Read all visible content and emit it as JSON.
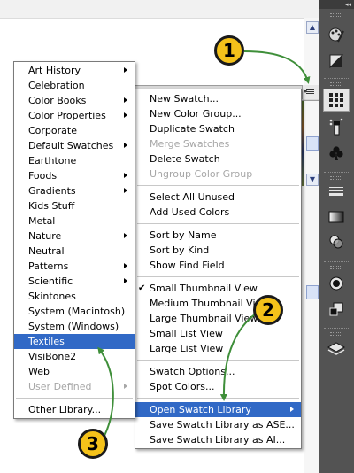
{
  "library_menu": {
    "items": [
      {
        "label": "Art History",
        "submenu": true
      },
      {
        "label": "Celebration",
        "submenu": false
      },
      {
        "label": "Color Books",
        "submenu": true
      },
      {
        "label": "Color Properties",
        "submenu": true
      },
      {
        "label": "Corporate",
        "submenu": false
      },
      {
        "label": "Default Swatches",
        "submenu": true
      },
      {
        "label": "Earthtone",
        "submenu": false
      },
      {
        "label": "Foods",
        "submenu": true
      },
      {
        "label": "Gradients",
        "submenu": true
      },
      {
        "label": "Kids Stuff",
        "submenu": false
      },
      {
        "label": "Metal",
        "submenu": false
      },
      {
        "label": "Nature",
        "submenu": true
      },
      {
        "label": "Neutral",
        "submenu": false
      },
      {
        "label": "Patterns",
        "submenu": true
      },
      {
        "label": "Scientific",
        "submenu": true
      },
      {
        "label": "Skintones",
        "submenu": false
      },
      {
        "label": "System (Macintosh)",
        "submenu": false
      },
      {
        "label": "System (Windows)",
        "submenu": false
      },
      {
        "label": "Textiles",
        "submenu": false,
        "selected": true
      },
      {
        "label": "VisiBone2",
        "submenu": false
      },
      {
        "label": "Web",
        "submenu": false
      },
      {
        "label": "User Defined",
        "submenu": true,
        "disabled": true
      }
    ],
    "other_library": "Other Library..."
  },
  "panel_menu": {
    "group1": [
      "New Swatch...",
      "New Color Group...",
      "Duplicate Swatch"
    ],
    "merge": "Merge Swatches",
    "delete": "Delete Swatch",
    "ungroup": "Ungroup Color Group",
    "select_unused": "Select All Unused",
    "add_used": "Add Used Colors",
    "sort_name": "Sort by Name",
    "sort_kind": "Sort by Kind",
    "show_find": "Show Find Field",
    "views": [
      {
        "label": "Small Thumbnail View",
        "checked": true
      },
      {
        "label": "Medium Thumbnail View",
        "checked": false
      },
      {
        "label": "Large Thumbnail View",
        "checked": false
      },
      {
        "label": "Small List View",
        "checked": false
      },
      {
        "label": "Large List View",
        "checked": false
      }
    ],
    "check_glyph": "✔",
    "swatch_options": "Swatch Options...",
    "spot_colors": "Spot Colors...",
    "open_library": "Open Swatch Library",
    "save_ase": "Save Swatch Library as ASE...",
    "save_ai": "Save Swatch Library as AI..."
  },
  "callouts": {
    "one": "1",
    "two": "2",
    "three": "3"
  },
  "dock": {
    "collapse_glyph": "◂◂"
  },
  "colors": {
    "highlight": "#3169c6",
    "callout": "#f4c21a",
    "arrow": "#3f8f3a",
    "dock": "#535353"
  }
}
